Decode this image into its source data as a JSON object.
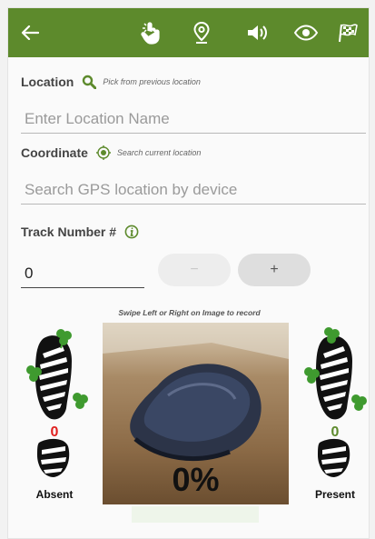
{
  "toolbar": {
    "back_icon": "arrow-left-icon",
    "icons": [
      "touch-hand-icon",
      "map-pin-icon",
      "speaker-icon",
      "eye-icon",
      "checkered-flag-icon"
    ],
    "background": "#5d8a2c"
  },
  "location": {
    "label": "Location",
    "hint": "Pick from previous location",
    "placeholder": "Enter Location Name",
    "value": ""
  },
  "coordinate": {
    "label": "Coordinate",
    "hint": "Search current location",
    "placeholder": "Search GPS location by device",
    "value": ""
  },
  "track": {
    "label": "Track Number #",
    "value": "0",
    "minus_label": "−",
    "plus_label": "+"
  },
  "swipe": {
    "hint": "Swipe Left or Right on Image to record",
    "percent": "0%"
  },
  "absent": {
    "label": "Absent",
    "count": "0",
    "color": "#e0201f"
  },
  "present": {
    "label": "Present",
    "count": "0",
    "color": "#5d8a2c"
  }
}
